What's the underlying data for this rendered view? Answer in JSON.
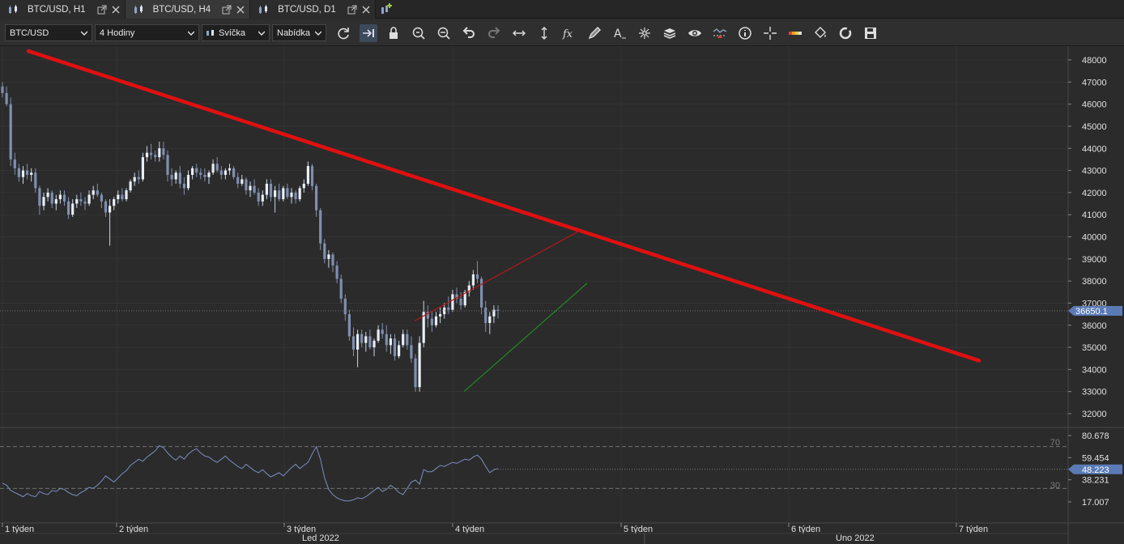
{
  "tabs": [
    {
      "label": "BTC/USD, H1",
      "active": false
    },
    {
      "label": "BTC/USD, H4",
      "active": true
    },
    {
      "label": "BTC/USD, D1",
      "active": false
    }
  ],
  "toolbar": {
    "symbol": "BTC/USD",
    "timeframe": "4 Hodiny",
    "chart_type": "Svíčka",
    "quote": "Nabídka",
    "icons": [
      "refresh-icon",
      "autoscroll-icon",
      "lock-icon",
      "zoom-in-icon",
      "zoom-out-icon",
      "undo-icon",
      "redo-icon",
      "horizontal-resize-icon",
      "vertical-resize-icon",
      "function-fx-icon",
      "pencil-icon",
      "text-tool-icon",
      "crosshair-star-icon",
      "layers-icon",
      "eye-icon",
      "indicator-chart-icon",
      "info-icon",
      "crosshair-icon",
      "color-palette-icon",
      "paint-bucket-icon",
      "circle-reset-icon",
      "save-icon"
    ]
  },
  "colors": {
    "background": "#2b2b2b",
    "grid": "#3a3a3a",
    "candle": "#7f8fb0",
    "trendline_main": "#e01010",
    "channel_upper": "#b01818",
    "channel_lower": "#1e8a1e",
    "rsi_line": "#7b8fc0",
    "price_label": "#5a7bb5"
  },
  "price_axis": {
    "ticks": [
      "48000",
      "47000",
      "46000",
      "45000",
      "44000",
      "43000",
      "42000",
      "41000",
      "40000",
      "39000",
      "38000",
      "37000",
      "36000",
      "35000",
      "34000",
      "33000",
      "32000"
    ],
    "current_price": "36650.1"
  },
  "rsi_axis": {
    "ticks": [
      "80.678",
      "59.454",
      "38.231",
      "17.007"
    ],
    "current_value": "48.223",
    "level_high": "70",
    "level_low": "30"
  },
  "time_axis": {
    "weeks": [
      "1 týden",
      "2 týden",
      "3 týden",
      "4 týden",
      "5 týden",
      "6 týden",
      "7 týden"
    ],
    "months": [
      "Led 2022",
      "Úno 2022"
    ]
  },
  "chart_data": {
    "type": "candlestick",
    "instrument": "BTC/USD",
    "timeframe": "4 Hodiny",
    "ylim": [
      31500,
      48500
    ],
    "candles": [
      [
        46800,
        47000,
        46300,
        46500
      ],
      [
        46500,
        46800,
        45900,
        46000
      ],
      [
        46000,
        46300,
        43200,
        43500
      ],
      [
        43500,
        43800,
        42800,
        43100
      ],
      [
        43100,
        43300,
        42500,
        42700
      ],
      [
        42700,
        43200,
        42400,
        43000
      ],
      [
        43000,
        43300,
        42600,
        42800
      ],
      [
        42800,
        43100,
        42500,
        42900
      ],
      [
        42900,
        43100,
        42000,
        42200
      ],
      [
        42200,
        42300,
        41000,
        41400
      ],
      [
        41400,
        42000,
        41200,
        41800
      ],
      [
        41800,
        42200,
        41600,
        42000
      ],
      [
        42000,
        42100,
        41300,
        41500
      ],
      [
        41500,
        41900,
        41200,
        41700
      ],
      [
        41700,
        42100,
        41500,
        41900
      ],
      [
        41900,
        42100,
        41400,
        41600
      ],
      [
        41600,
        41800,
        40800,
        41000
      ],
      [
        41000,
        41700,
        40900,
        41500
      ],
      [
        41500,
        41900,
        41300,
        41700
      ],
      [
        41700,
        42000,
        41400,
        41600
      ],
      [
        41600,
        41800,
        41200,
        41500
      ],
      [
        41500,
        42100,
        41400,
        41900
      ],
      [
        41900,
        42300,
        41700,
        42100
      ],
      [
        42100,
        42400,
        41800,
        41900
      ],
      [
        41900,
        42000,
        41300,
        41600
      ],
      [
        41600,
        41700,
        40900,
        41100
      ],
      [
        41100,
        41700,
        39600,
        41400
      ],
      [
        41400,
        41800,
        41200,
        41700
      ],
      [
        41700,
        42100,
        41500,
        41900
      ],
      [
        41900,
        42200,
        41600,
        41700
      ],
      [
        41700,
        42200,
        41600,
        42100
      ],
      [
        42100,
        42600,
        42000,
        42500
      ],
      [
        42500,
        42900,
        42300,
        42700
      ],
      [
        42700,
        43000,
        42400,
        42600
      ],
      [
        42600,
        43800,
        42500,
        43600
      ],
      [
        43600,
        44100,
        43400,
        43800
      ],
      [
        43800,
        44200,
        43500,
        43700
      ],
      [
        43700,
        43900,
        43400,
        43600
      ],
      [
        43600,
        44300,
        43400,
        44000
      ],
      [
        44000,
        44300,
        43500,
        43700
      ],
      [
        43700,
        43900,
        42500,
        42800
      ],
      [
        42800,
        43100,
        42300,
        42600
      ],
      [
        42600,
        43000,
        42400,
        42900
      ],
      [
        42900,
        43200,
        42200,
        42400
      ],
      [
        42400,
        42700,
        41900,
        42200
      ],
      [
        42200,
        43000,
        42100,
        42800
      ],
      [
        42800,
        43200,
        42600,
        43100
      ],
      [
        43100,
        43300,
        42700,
        42900
      ],
      [
        42900,
        43100,
        42600,
        42800
      ],
      [
        42800,
        43100,
        42500,
        42700
      ],
      [
        42700,
        43000,
        42400,
        42900
      ],
      [
        42900,
        43500,
        42800,
        43300
      ],
      [
        43300,
        43600,
        42900,
        43000
      ],
      [
        43000,
        43200,
        42600,
        42800
      ],
      [
        42800,
        43100,
        42600,
        43000
      ],
      [
        43000,
        43300,
        42800,
        43100
      ],
      [
        43100,
        43200,
        42600,
        42700
      ],
      [
        42700,
        42900,
        42200,
        42400
      ],
      [
        42400,
        42800,
        42300,
        42600
      ],
      [
        42600,
        42700,
        41900,
        42100
      ],
      [
        42100,
        42500,
        41800,
        42300
      ],
      [
        42300,
        42600,
        41900,
        42000
      ],
      [
        42000,
        42200,
        41400,
        41600
      ],
      [
        41600,
        42100,
        41400,
        41900
      ],
      [
        41900,
        42600,
        41700,
        42400
      ],
      [
        42400,
        42600,
        41600,
        41800
      ],
      [
        41800,
        42300,
        41100,
        42100
      ],
      [
        42100,
        42400,
        41600,
        41700
      ],
      [
        41700,
        42300,
        41600,
        42200
      ],
      [
        42200,
        42400,
        41700,
        41800
      ],
      [
        41800,
        42200,
        41500,
        42000
      ],
      [
        42000,
        42100,
        41500,
        41700
      ],
      [
        41700,
        42300,
        41600,
        42200
      ],
      [
        42200,
        42600,
        42000,
        42400
      ],
      [
        42400,
        43400,
        42300,
        43200
      ],
      [
        43200,
        43300,
        42100,
        42300
      ],
      [
        42300,
        42400,
        40900,
        41200
      ],
      [
        41200,
        41300,
        39400,
        39700
      ],
      [
        39700,
        39900,
        38800,
        39000
      ],
      [
        39000,
        39400,
        38600,
        39200
      ],
      [
        39200,
        39300,
        38400,
        38700
      ],
      [
        38700,
        38900,
        37900,
        38100
      ],
      [
        38100,
        38300,
        37000,
        37200
      ],
      [
        37200,
        37400,
        36200,
        36500
      ],
      [
        36500,
        36700,
        35300,
        35500
      ],
      [
        35500,
        35900,
        34600,
        34900
      ],
      [
        34900,
        35800,
        34100,
        35600
      ],
      [
        35600,
        35800,
        35000,
        35200
      ],
      [
        35200,
        35700,
        34800,
        35500
      ],
      [
        35500,
        35800,
        34900,
        35000
      ],
      [
        35000,
        35400,
        34600,
        35300
      ],
      [
        35300,
        36000,
        35200,
        35800
      ],
      [
        35800,
        36100,
        35400,
        35600
      ],
      [
        35600,
        36000,
        34800,
        35100
      ],
      [
        35100,
        35600,
        34700,
        35400
      ],
      [
        35400,
        35600,
        34400,
        34600
      ],
      [
        34600,
        35300,
        34500,
        35100
      ],
      [
        35100,
        35800,
        35000,
        35600
      ],
      [
        35600,
        35800,
        34900,
        35100
      ],
      [
        35100,
        35500,
        34300,
        34500
      ],
      [
        34500,
        34700,
        33000,
        33200
      ],
      [
        33200,
        35500,
        33000,
        35200
      ],
      [
        35200,
        37100,
        35000,
        36600
      ],
      [
        36600,
        36900,
        35900,
        36300
      ],
      [
        36300,
        36600,
        35700,
        36000
      ],
      [
        36000,
        36600,
        35900,
        36400
      ],
      [
        36400,
        36800,
        36100,
        36500
      ],
      [
        36500,
        37000,
        36300,
        36800
      ],
      [
        36800,
        37300,
        36500,
        36700
      ],
      [
        36700,
        37600,
        36600,
        37400
      ],
      [
        37400,
        37700,
        37000,
        37200
      ],
      [
        37200,
        37500,
        36700,
        36900
      ],
      [
        36900,
        37600,
        36800,
        37500
      ],
      [
        37500,
        38000,
        37300,
        37800
      ],
      [
        37800,
        38500,
        37600,
        38300
      ],
      [
        38300,
        38900,
        37900,
        38100
      ],
      [
        38100,
        38200,
        36500,
        36800
      ],
      [
        36800,
        37100,
        35700,
        36100
      ],
      [
        36100,
        36600,
        35600,
        36400
      ],
      [
        36400,
        36900,
        36100,
        36700
      ],
      [
        36700,
        36900,
        36300,
        36650
      ]
    ],
    "x_ticks": [
      "1 týden",
      "2 týden",
      "3 týden",
      "4 týden",
      "5 týden",
      "6 týden",
      "7 týden"
    ],
    "months": [
      "Led 2022",
      "Úno 2022"
    ],
    "drawings": [
      {
        "type": "trendline",
        "color": "#e01010",
        "from_price": 48400,
        "to_price": 34400
      },
      {
        "type": "channel-upper",
        "color": "#b01818",
        "from_price": 36200,
        "to_price": 40300
      },
      {
        "type": "channel-lower",
        "color": "#1e8a1e",
        "from_price": 33000,
        "to_price": 37900
      }
    ],
    "rsi": {
      "levels": [
        70,
        30
      ],
      "ylim": [
        10,
        88
      ],
      "values": [
        35,
        33,
        28,
        26,
        24,
        22,
        25,
        23,
        22,
        27,
        25,
        24,
        28,
        27,
        30,
        29,
        26,
        24,
        23,
        26,
        28,
        31,
        30,
        33,
        37,
        42,
        39,
        36,
        40,
        44,
        47,
        52,
        55,
        58,
        56,
        60,
        63,
        66,
        71,
        69,
        64,
        60,
        57,
        61,
        58,
        63,
        66,
        68,
        64,
        61,
        60,
        57,
        55,
        58,
        61,
        57,
        54,
        51,
        49,
        53,
        50,
        47,
        45,
        48,
        44,
        41,
        43,
        45,
        42,
        46,
        50,
        53,
        49,
        52,
        55,
        63,
        70,
        58,
        40,
        29,
        24,
        21,
        19,
        18,
        18,
        19,
        21,
        20,
        22,
        25,
        28,
        31,
        27,
        29,
        33,
        30,
        26,
        24,
        30,
        36,
        38,
        34,
        48,
        46,
        46,
        49,
        52,
        51,
        53,
        55,
        54,
        56,
        58,
        57,
        60,
        62,
        58,
        51,
        45,
        48,
        49
      ]
    }
  }
}
